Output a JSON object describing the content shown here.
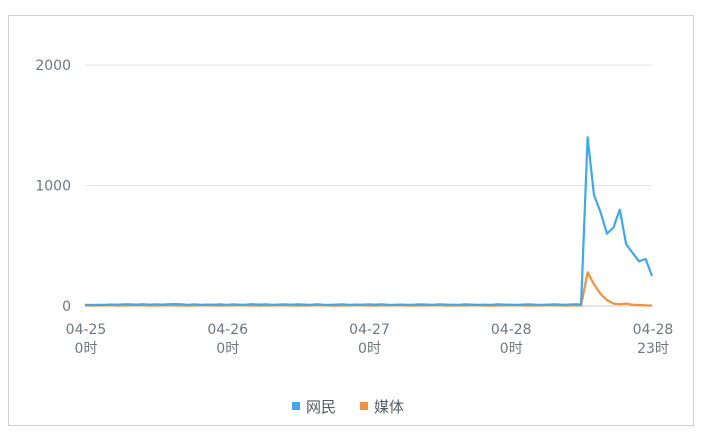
{
  "chart_data": {
    "type": "line",
    "x_ticks": [
      {
        "date": "04-25",
        "hour": "0时"
      },
      {
        "date": "04-26",
        "hour": "0时"
      },
      {
        "date": "04-27",
        "hour": "0时"
      },
      {
        "date": "04-28",
        "hour": "0时"
      },
      {
        "date": "04-28",
        "hour": "23时"
      }
    ],
    "y_ticks": [
      "0",
      "1000",
      "2000"
    ],
    "ylim": [
      0,
      2000
    ],
    "grid": true,
    "legend_position": "bottom",
    "series": [
      {
        "name": "网民",
        "color": "#3fa8e8",
        "values": [
          10,
          8,
          10,
          9,
          12,
          11,
          14,
          13,
          12,
          15,
          11,
          14,
          12,
          15,
          16,
          13,
          10,
          14,
          9,
          12,
          11,
          13,
          10,
          14,
          11,
          12,
          15,
          12,
          13,
          10,
          12,
          14,
          11,
          13,
          12,
          10,
          14,
          11,
          9,
          12,
          13,
          10,
          12,
          11,
          14,
          12,
          13,
          11,
          10,
          12,
          9,
          11,
          13,
          12,
          10,
          14,
          12,
          11,
          10,
          13,
          12,
          9,
          11,
          10,
          13,
          12,
          11,
          10,
          12,
          14,
          11,
          10,
          12,
          13,
          11,
          12,
          14,
          15,
          1400,
          920,
          780,
          600,
          650,
          800,
          510,
          440,
          370,
          390,
          250
        ]
      },
      {
        "name": "媒体",
        "color": "#f5913c",
        "values": [
          4,
          3,
          5,
          4,
          6,
          3,
          5,
          4,
          6,
          5,
          4,
          3,
          5,
          6,
          4,
          5,
          3,
          4,
          6,
          5,
          4,
          3,
          5,
          4,
          6,
          5,
          4,
          3,
          5,
          4,
          6,
          5,
          4,
          3,
          5,
          4,
          6,
          5,
          4,
          3,
          5,
          4,
          6,
          5,
          4,
          3,
          5,
          4,
          6,
          5,
          4,
          3,
          5,
          4,
          6,
          5,
          4,
          3,
          5,
          4,
          6,
          5,
          4,
          3,
          5,
          4,
          6,
          5,
          4,
          3,
          5,
          4,
          6,
          5,
          4,
          3,
          5,
          4,
          280,
          180,
          100,
          50,
          20,
          15,
          20,
          10,
          8,
          5,
          4
        ]
      }
    ]
  }
}
